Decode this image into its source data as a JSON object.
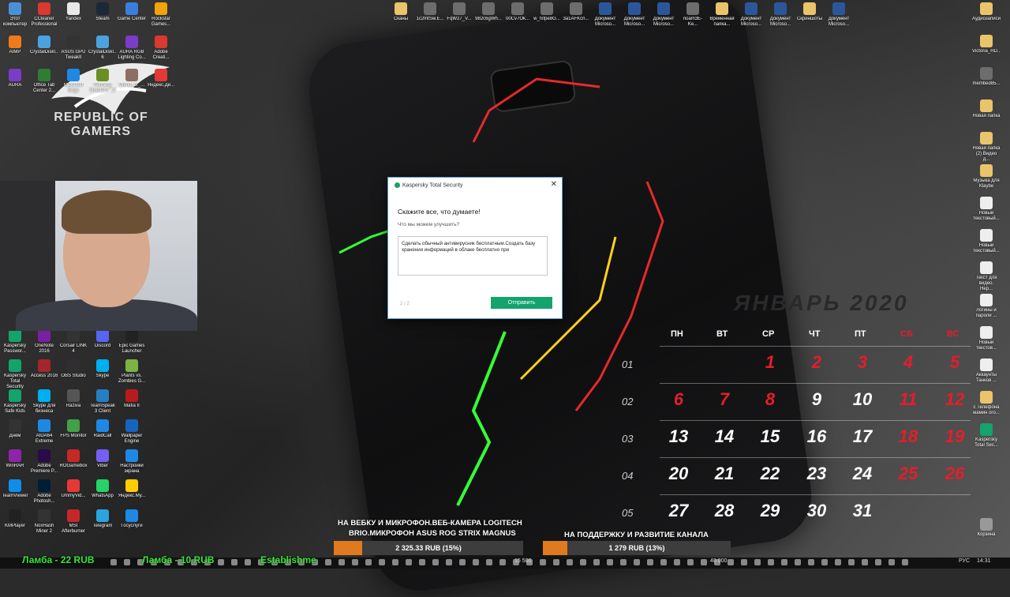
{
  "desktop_icons_left": [
    {
      "label": "Этот компьютер",
      "color": "#4a90d9"
    },
    {
      "label": "CCleaner Professional",
      "color": "#d9392f"
    },
    {
      "label": "Yandex",
      "color": "#e8e8e8"
    },
    {
      "label": "Steam",
      "color": "#1b2838"
    },
    {
      "label": "Game Center",
      "color": "#3b7ddd"
    },
    {
      "label": "Rockstar Games...",
      "color": "#f0a30a"
    },
    {
      "label": "AIMP",
      "color": "#f07b16"
    },
    {
      "label": "CrystalDiskI...",
      "color": "#4aa3df"
    },
    {
      "label": "ASUS GPU TweakII",
      "color": "#333"
    },
    {
      "label": "CrystalDiskI... 6",
      "color": "#4aa3df"
    },
    {
      "label": "AURA RGB Lighting Co...",
      "color": "#7a3cc9"
    },
    {
      "label": "Adobe Creati...",
      "color": "#d9392f"
    },
    {
      "label": "AURA",
      "color": "#7a3cc9"
    },
    {
      "label": "Office Tab Center 2...",
      "color": "#2e7d32"
    },
    {
      "label": "Microsoft Edge",
      "color": "#1e88e5"
    },
    {
      "label": "Farming Simulator 19",
      "color": "#6b8e23"
    },
    {
      "label": "World_of_...",
      "color": "#8d6e63"
    },
    {
      "label": "Яндекс.Ди...",
      "color": "#e53935"
    }
  ],
  "desktop_icons_left_bottom": [
    {
      "label": "Kaspersky Passwor...",
      "color": "#13a36c"
    },
    {
      "label": "OneNote 2016",
      "color": "#7b1fa2"
    },
    {
      "label": "Corsair LINK 4",
      "color": "#333"
    },
    {
      "label": "Discord",
      "color": "#5865f2"
    },
    {
      "label": "Epic Games Launcher",
      "color": "#222"
    },
    {
      "label": "Kaspersky Total Security",
      "color": "#13a36c"
    },
    {
      "label": "Access 2016",
      "color": "#a4262c"
    },
    {
      "label": "OBS Studio",
      "color": "#302e31"
    },
    {
      "label": "Skype",
      "color": "#00aff0"
    },
    {
      "label": "Plants vs. Zombies G...",
      "color": "#7cb342"
    },
    {
      "label": "Kaspersky Safe Kids",
      "color": "#13a36c"
    },
    {
      "label": "Skype для бизнеса",
      "color": "#00aff0"
    },
    {
      "label": "Raziva",
      "color": "#555"
    },
    {
      "label": "TeamSpeak 3 Client",
      "color": "#2580c3"
    },
    {
      "label": "Mafia II",
      "color": "#b71c1c"
    },
    {
      "label": "Днем",
      "color": "#333"
    },
    {
      "label": "AIDA64 Extreme",
      "color": "#1e88e5"
    },
    {
      "label": "FPS Monitor",
      "color": "#43a047"
    },
    {
      "label": "RaidCall",
      "color": "#1e88e5"
    },
    {
      "label": "Wallpaper Engine",
      "color": "#1565c0"
    },
    {
      "label": "WinRAR",
      "color": "#8e24aa"
    },
    {
      "label": "Adobe Premiere P...",
      "color": "#2a0a4a"
    },
    {
      "label": "ROGamebox",
      "color": "#c62828"
    },
    {
      "label": "Viber",
      "color": "#7360f2"
    },
    {
      "label": "Настройки экрана",
      "color": "#1e88e5"
    },
    {
      "label": "TeamViewer",
      "color": "#0e8ee9"
    },
    {
      "label": "Adobe Photosh...",
      "color": "#001e36"
    },
    {
      "label": "UmmyVid...",
      "color": "#e53935"
    },
    {
      "label": "WhatsApp",
      "color": "#25d366"
    },
    {
      "label": "Яндекс.Му...",
      "color": "#ffcc00"
    },
    {
      "label": "KMPlayer",
      "color": "#222"
    },
    {
      "label": "NoxHash Miner 2",
      "color": "#333"
    },
    {
      "label": "MSI Afterburner",
      "color": "#c62828"
    },
    {
      "label": "Telegram",
      "color": "#2aa3df"
    },
    {
      "label": "Госуслуги",
      "color": "#1e88e5"
    }
  ],
  "desktop_icons_top": [
    {
      "label": "Сканы",
      "color": "#e9c46a"
    },
    {
      "label": "1c2mtSw.E...",
      "color": "#6d6d6d"
    },
    {
      "label": "FqW27_V...",
      "color": "#6d6d6d"
    },
    {
      "label": "982c6gWh...",
      "color": "#6d6d6d"
    },
    {
      "label": "00Cv7Ok...",
      "color": "#6d6d6d"
    },
    {
      "label": "w_fxfpe8G...",
      "color": "#6d6d6d"
    },
    {
      "label": "3a1AFKcn...",
      "color": "#6d6d6d"
    },
    {
      "label": "Документ Microso...",
      "color": "#2b579a"
    },
    {
      "label": "Документ Microso...",
      "color": "#2b579a"
    },
    {
      "label": "Документ Microso...",
      "color": "#2b579a"
    },
    {
      "label": "noam3E-Ke...",
      "color": "#6d6d6d"
    },
    {
      "label": "Временная папка...",
      "color": "#e9c46a"
    },
    {
      "label": "Документ Microso...",
      "color": "#2b579a"
    },
    {
      "label": "Документ Microso...",
      "color": "#2b579a"
    },
    {
      "label": "Скриншоты",
      "color": "#e9c46a"
    },
    {
      "label": "Документ Microso...",
      "color": "#2b579a"
    }
  ],
  "desktop_icons_right": [
    {
      "label": "Аудиозаписи",
      "color": "#e9c46a"
    },
    {
      "label": "Victoria_HD...",
      "color": "#e9c46a"
    },
    {
      "label": "membed85...",
      "color": "#6d6d6d"
    },
    {
      "label": "Новая папка",
      "color": "#e9c46a"
    },
    {
      "label": "Новая папка (2) Видео д...",
      "color": "#e9c46a"
    },
    {
      "label": "Музыка для Klaybe",
      "color": "#e9c46a"
    },
    {
      "label": "Новый текстовый...",
      "color": "#eee"
    },
    {
      "label": "Новый текстовый...",
      "color": "#eee"
    },
    {
      "label": "Текст для видео. Нер...",
      "color": "#eee"
    },
    {
      "label": "Логины и пароли ...",
      "color": "#eee"
    },
    {
      "label": "Новый текстов...",
      "color": "#eee"
    },
    {
      "label": "Аккаунты Танков ...",
      "color": "#eee"
    },
    {
      "label": "с Телефона мамин ого...",
      "color": "#e9c46a"
    },
    {
      "label": "Kaspersky Total Sec...",
      "color": "#13a36c"
    },
    {
      "label": "Корзина",
      "color": "#999"
    }
  ],
  "wallpaper": {
    "brand_line1": "REPUBLIC OF",
    "brand_line2": "GAMERS"
  },
  "dialog": {
    "app_title": "Kaspersky Total Security",
    "close_label": "✕",
    "heading": "Скажите все, что думаете!",
    "subheading": "Что мы можем улучшить?",
    "feedback_text": "Сделать обычный антивирусник бесплатным.Создать базу хранения информаций в облаке бесплатно при",
    "pager": "2 / 2",
    "send_label": "Отправить"
  },
  "calendar": {
    "title": "ЯНВАРЬ 2020",
    "weekdays": [
      "ПН",
      "ВТ",
      "СР",
      "ЧТ",
      "ПТ",
      "СБ",
      "ВС"
    ],
    "weeks": [
      {
        "num": "01",
        "days": [
          "",
          "",
          "1",
          "2",
          "3",
          "4",
          "5"
        ],
        "red": [
          false,
          false,
          true,
          true,
          true,
          true,
          true
        ]
      },
      {
        "num": "02",
        "days": [
          "6",
          "7",
          "8",
          "9",
          "10",
          "11",
          "12"
        ],
        "red": [
          true,
          true,
          true,
          false,
          false,
          true,
          true
        ]
      },
      {
        "num": "03",
        "days": [
          "13",
          "14",
          "15",
          "16",
          "17",
          "18",
          "19"
        ],
        "red": [
          false,
          false,
          false,
          false,
          false,
          true,
          true
        ]
      },
      {
        "num": "04",
        "days": [
          "20",
          "21",
          "22",
          "23",
          "24",
          "25",
          "26"
        ],
        "red": [
          false,
          false,
          false,
          false,
          false,
          true,
          true
        ]
      },
      {
        "num": "05",
        "days": [
          "27",
          "28",
          "29",
          "30",
          "31",
          "",
          ""
        ],
        "red": [
          false,
          false,
          false,
          false,
          false,
          false,
          false
        ]
      }
    ]
  },
  "stream_overlay": {
    "goal1_title_line1": "НА ВЕБКУ И МИКРОФОН.ВЕБ-КАМЕРА LOGITECH",
    "goal1_title_line2": "BRIO.МИКРОФОН ASUS ROG STRIX MAGNUS",
    "goal1_progress": "2 325.33 RUB (15%)",
    "goal1_fraction": 0.15,
    "goal2_title": "НА ПОДДЕРЖКУ И РАЗВИТИЕ КАНАЛА",
    "goal2_progress": "1 279 RUB (13%)",
    "goal2_fraction": 0.13,
    "goal_bar_color": "#e07a1f"
  },
  "taskbar": {
    "ticker_1": "Ламба - 22 RUB",
    "ticker_2": "Ламба - 10 RUB",
    "ticker_3": "Establishme",
    "clock": "14:31",
    "lang": "РУС",
    "counter_a": "15 500",
    "counter_b": "40 000"
  }
}
